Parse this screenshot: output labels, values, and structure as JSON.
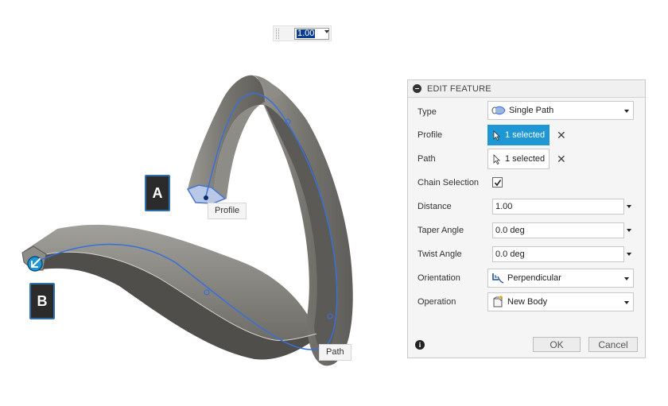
{
  "mini_input": {
    "value": "1.00"
  },
  "callouts": {
    "a": "A",
    "b": "B"
  },
  "tags": {
    "profile": "Profile",
    "path": "Path"
  },
  "dialog": {
    "title": "EDIT FEATURE",
    "rows": {
      "type": {
        "label": "Type",
        "value": "Single Path",
        "icon": "single-path-icon"
      },
      "profile": {
        "label": "Profile",
        "value": "1 selected",
        "state": "active"
      },
      "path": {
        "label": "Path",
        "value": "1 selected",
        "state": "inactive"
      },
      "chain": {
        "label": "Chain Selection",
        "checked": true
      },
      "distance": {
        "label": "Distance",
        "value": "1.00"
      },
      "taper": {
        "label": "Taper Angle",
        "value": "0.0 deg"
      },
      "twist": {
        "label": "Twist Angle",
        "value": "0.0 deg"
      },
      "orientation": {
        "label": "Orientation",
        "value": "Perpendicular",
        "icon": "perpendicular-icon"
      },
      "operation": {
        "label": "Operation",
        "value": "New Body",
        "icon": "new-body-icon"
      }
    },
    "ok_label": "OK",
    "cancel_label": "Cancel"
  },
  "colors": {
    "accent": "#1e97d4",
    "path_line": "#3a6fd8",
    "body": "#7d7b76",
    "callout_border": "#2f6fab"
  }
}
